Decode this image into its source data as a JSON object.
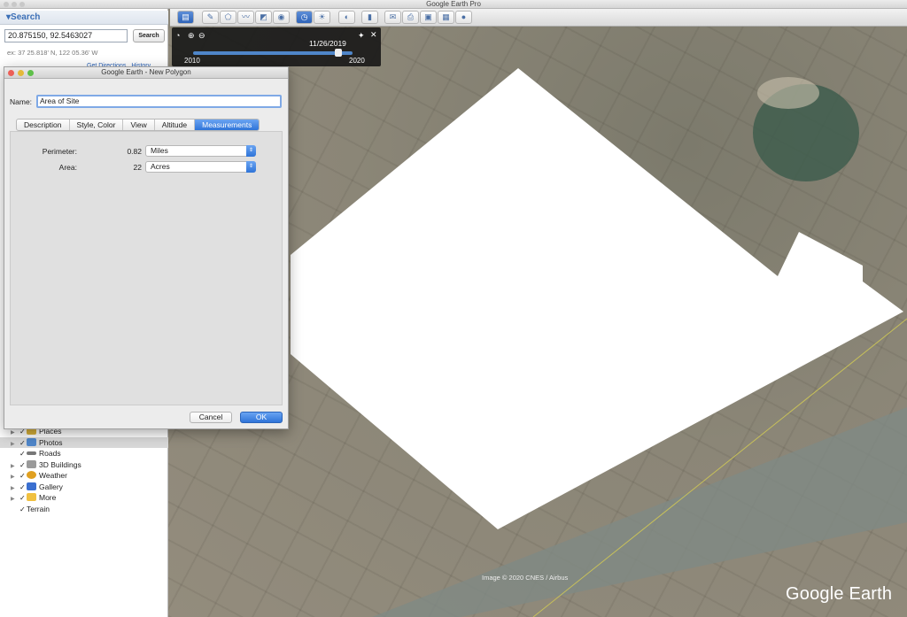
{
  "app": {
    "title": "Google Earth Pro"
  },
  "search": {
    "header": "▾Search",
    "query": "20.875150, 92.5463027",
    "button": "Search",
    "example": "ex: 37 25.818' N, 122 05.36' W",
    "links": [
      "Get Directions",
      "History"
    ]
  },
  "layers": [
    {
      "label": "Places",
      "checked": true,
      "icon_color": "#d9b23a"
    },
    {
      "label": "Photos",
      "checked": true,
      "icon_color": "#4f86c9",
      "selected": true
    },
    {
      "label": "Roads",
      "checked": true,
      "icon_color": "#777777"
    },
    {
      "label": "3D Buildings",
      "checked": true,
      "icon_color": "#9a9a9a"
    },
    {
      "label": "Weather",
      "checked": true,
      "icon_color": "#e0a020"
    },
    {
      "label": "Gallery",
      "checked": true,
      "icon_color": "#3a6fd0"
    },
    {
      "label": "More",
      "checked": true,
      "icon_color": "#f0c040"
    },
    {
      "label": "Terrain",
      "checked": true,
      "icon_color": ""
    }
  ],
  "timeslider": {
    "date": "11/26/2019",
    "start": "2010",
    "end": "2020",
    "position": 0.93
  },
  "dialog": {
    "title": "Google Earth - New Polygon",
    "name_label": "Name:",
    "name_value": "Area of Site",
    "tabs": [
      "Description",
      "Style, Color",
      "View",
      "Altitude",
      "Measurements"
    ],
    "active_tab": "Measurements",
    "perimeter": {
      "label": "Perimeter:",
      "value": "0.82",
      "unit": "Miles"
    },
    "area": {
      "label": "Area:",
      "value": "22",
      "unit": "Acres"
    },
    "cancel": "Cancel",
    "ok": "OK"
  },
  "map": {
    "credit": "Image © 2020 CNES / Airbus",
    "logo": "Google Earth"
  }
}
